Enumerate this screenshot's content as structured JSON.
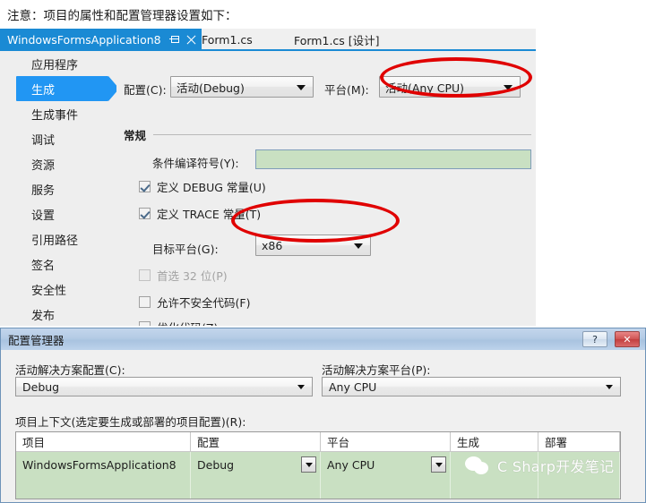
{
  "caption": "注意：项目的属性和配置管理器设置如下：",
  "vs_window": {
    "tabs": [
      {
        "label": "WindowsFormsApplication8",
        "active": true,
        "pin_icon": "pin-icon",
        "close_icon": "close-icon"
      },
      {
        "label": "Form1.cs",
        "active": false
      },
      {
        "label": "Form1.cs [设计]",
        "active": false
      }
    ],
    "sidebar": {
      "items": [
        {
          "label": "应用程序",
          "selected": false
        },
        {
          "label": "生成",
          "selected": true
        },
        {
          "label": "生成事件",
          "selected": false
        },
        {
          "label": "调试",
          "selected": false
        },
        {
          "label": "资源",
          "selected": false
        },
        {
          "label": "服务",
          "selected": false
        },
        {
          "label": "设置",
          "selected": false
        },
        {
          "label": "引用路径",
          "selected": false
        },
        {
          "label": "签名",
          "selected": false
        },
        {
          "label": "安全性",
          "selected": false
        },
        {
          "label": "发布",
          "selected": false
        }
      ]
    },
    "config_row": {
      "configuration_label": "配置(C):",
      "configuration_value": "活动(Debug)",
      "platform_label": "平台(M):",
      "platform_value": "活动(Any CPU)"
    },
    "general_section": {
      "title": "常规",
      "conditional_symbols_label": "条件编译符号(Y):",
      "conditional_symbols_value": "",
      "define_debug_label": "定义 DEBUG 常量(U)",
      "define_debug_checked": true,
      "define_trace_label": "定义 TRACE 常量(T)",
      "define_trace_checked": true,
      "target_platform_label": "目标平台(G):",
      "target_platform_value": "x86",
      "prefer32_label": "首选 32 位(P)",
      "prefer32_checked": false,
      "prefer32_disabled": true,
      "allow_unsafe_label": "允许不安全代码(F)",
      "allow_unsafe_checked": false,
      "optimize_label": "优化代码(Z)",
      "optimize_checked": false
    },
    "clipped_text": "…………"
  },
  "annotations": {
    "color": "#e00000",
    "ellipse_platform": "platform-combo-highlight",
    "ellipse_target": "target-platform-combo-highlight"
  },
  "dialog": {
    "title": "配置管理器",
    "help_button": "?",
    "close_button": "✕",
    "active_solution_config_label": "活动解决方案配置(C):",
    "active_solution_config_value": "Debug",
    "active_solution_platform_label": "活动解决方案平台(P):",
    "active_solution_platform_value": "Any CPU",
    "project_contexts_label": "项目上下文(选定要生成或部署的项目配置)(R):",
    "grid": {
      "headers": [
        "项目",
        "配置",
        "平台",
        "生成",
        "部署"
      ],
      "rows": [
        {
          "project": "WindowsFormsApplication8",
          "configuration": "Debug",
          "platform": "Any CPU",
          "build": "",
          "deploy": ""
        }
      ]
    }
  },
  "watermark": {
    "logo_icon": "wechat-icon",
    "text": "C Sharp开发笔记"
  }
}
